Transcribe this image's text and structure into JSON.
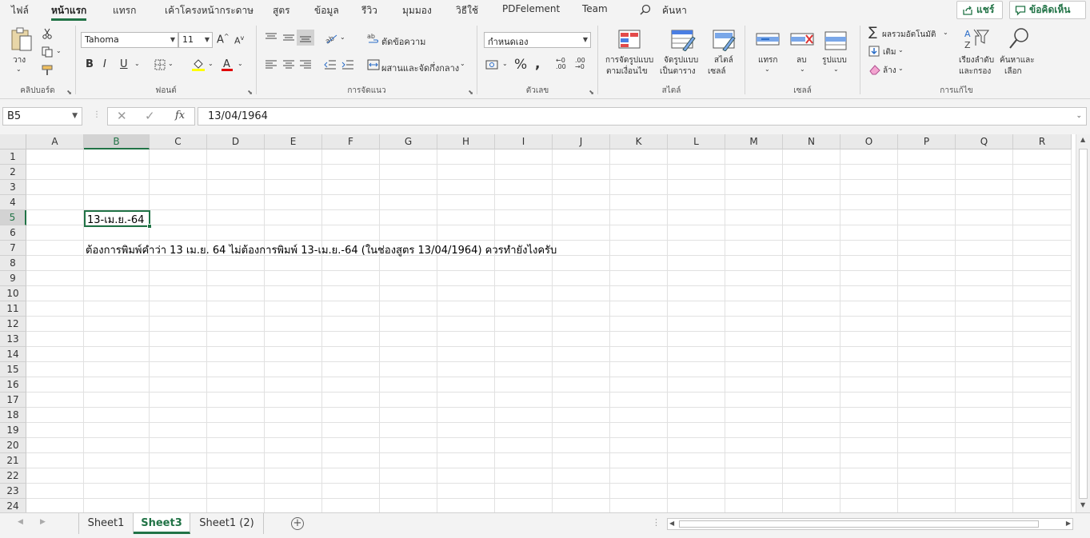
{
  "ribbon_tabs": [
    "ไฟล์",
    "หน้าแรก",
    "แทรก",
    "เค้าโครงหน้ากระดาษ",
    "สูตร",
    "ข้อมูล",
    "รีวิว",
    "มุมมอง",
    "วิธีใช้",
    "PDFelement",
    "Team"
  ],
  "active_tab": "หน้าแรก",
  "search_label": "ค้นหา",
  "share_label": "แชร์",
  "comments_label": "ข้อคิดเห็น",
  "ribbon": {
    "clipboard": {
      "paste": "วาง",
      "group": "คลิปบอร์ด"
    },
    "font": {
      "name": "Tahoma",
      "size": "11",
      "bold": "B",
      "italic": "I",
      "underline": "U",
      "group": "ฟอนต์"
    },
    "alignment": {
      "wrap": "ตัดข้อความ",
      "merge": "ผสานและจัดกึ่งกลาง",
      "group": "การจัดแนว"
    },
    "number": {
      "format": "กำหนดเอง",
      "group": "ตัวเลข"
    },
    "styles": {
      "conditional_1": "การจัดรูปแบบ",
      "conditional_2": "ตามเงื่อนไข",
      "table_1": "จัดรูปแบบ",
      "table_2": "เป็นตาราง",
      "cell_1": "สไตล์",
      "cell_2": "เซลล์",
      "group": "สไตล์"
    },
    "cells": {
      "insert": "แทรก",
      "delete": "ลบ",
      "format": "รูปแบบ",
      "group": "เซลล์"
    },
    "editing": {
      "autosum": "ผลรวมอัตโนมัติ",
      "fill": "เติม",
      "clear": "ล้าง",
      "sort_1": "เรียงลำดับ",
      "sort_2": "และกรอง",
      "find_1": "ค้นหาและ",
      "find_2": "เลือก",
      "group": "การแก้ไข"
    }
  },
  "name_box": "B5",
  "formula": "13/04/1964",
  "columns": [
    "A",
    "B",
    "C",
    "D",
    "E",
    "F",
    "G",
    "H",
    "I",
    "J",
    "K",
    "L",
    "M",
    "N",
    "O",
    "P",
    "Q",
    "R"
  ],
  "rows": [
    "1",
    "2",
    "3",
    "4",
    "5",
    "6",
    "7",
    "8",
    "9",
    "10",
    "11",
    "12",
    "13",
    "14",
    "15",
    "16",
    "17",
    "18",
    "19",
    "20",
    "21",
    "22",
    "23",
    "24"
  ],
  "cells": {
    "B5": "13-เม.ย.-64",
    "B7": "ต้องการพิมพ์คำว่า 13 เม.ย. 64 ไม่ต้องการพิมพ์ 13-เม.ย.-64 (ในช่องสูตร 13/04/1964) ควรทำยังไงครับ"
  },
  "sheet_tabs": [
    "Sheet1",
    "Sheet3",
    "Sheet1 (2)"
  ],
  "active_sheet": "Sheet3",
  "colors": {
    "accent": "#217346"
  }
}
